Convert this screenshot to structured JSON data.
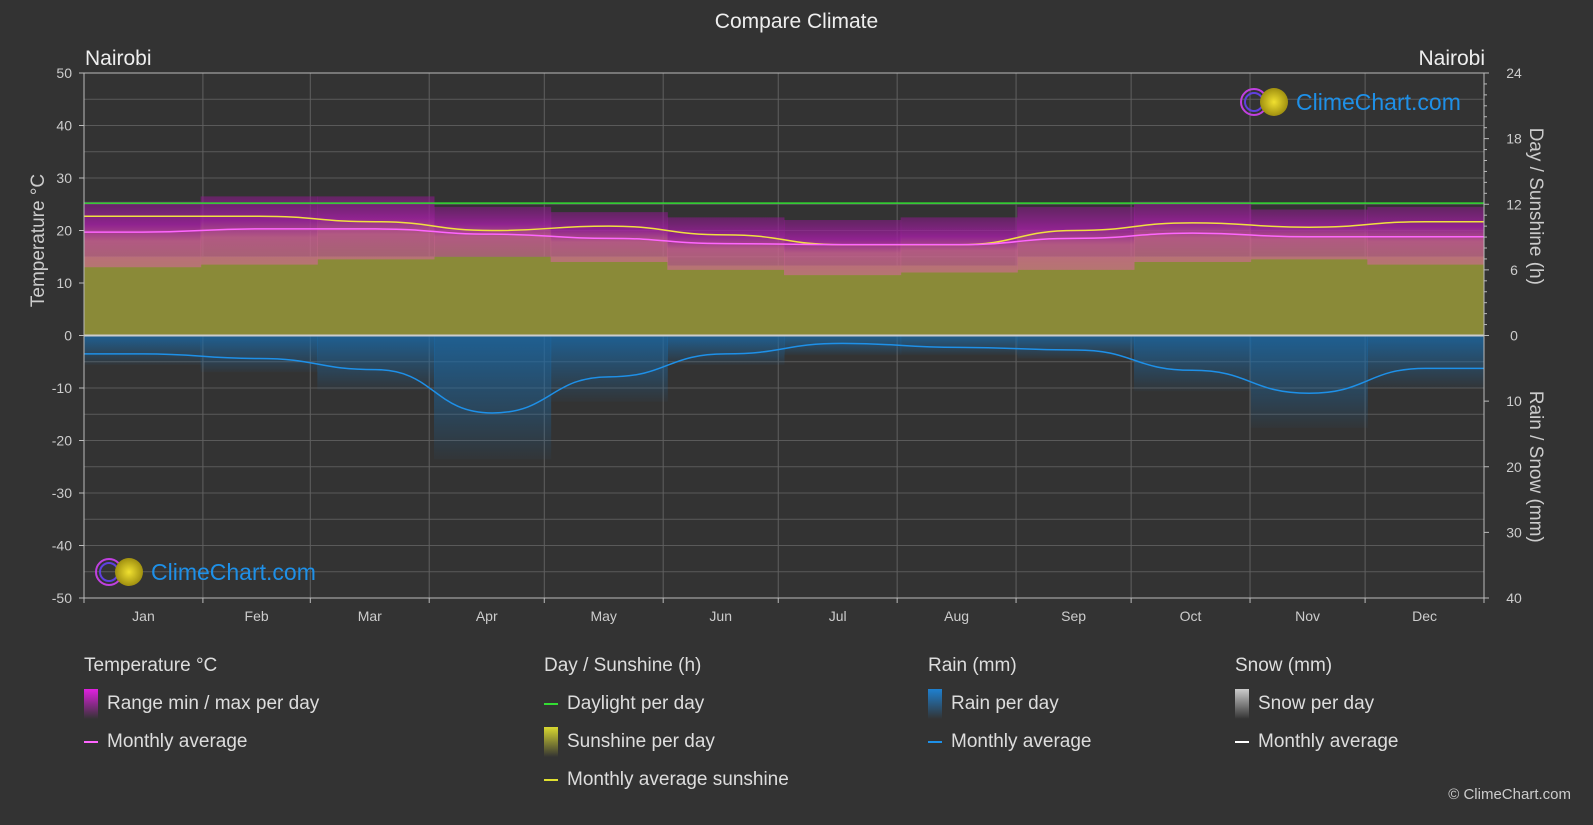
{
  "title": "Compare Climate",
  "city_left": "Nairobi",
  "city_right": "Nairobi",
  "logo_text": "ClimeChart.com",
  "copyright": "© ClimeChart.com",
  "colors": {
    "background": "#333333",
    "temp_range": "#e020e0",
    "temp_avg": "#ff66ff",
    "daylight": "#33dd33",
    "sunshine_fill": "#8a8a38",
    "sunshine_avg": "#f0e040",
    "rain_fill": "#1a6aa8",
    "rain_avg": "#1e90e8",
    "snow_avg": "#ffffff",
    "logo": "#1e90e8"
  },
  "chart_data": {
    "type": "area",
    "title": "Compare Climate",
    "categories": [
      "Jan",
      "Feb",
      "Mar",
      "Apr",
      "May",
      "Jun",
      "Jul",
      "Aug",
      "Sep",
      "Oct",
      "Nov",
      "Dec"
    ],
    "axes": {
      "left": {
        "label": "Temperature °C",
        "range": [
          -50,
          50
        ],
        "ticks": [
          50,
          40,
          30,
          20,
          10,
          0,
          -10,
          -20,
          -30,
          -40,
          -50
        ]
      },
      "right_top": {
        "label": "Day / Sunshine (h)",
        "range": [
          0,
          24
        ],
        "ticks": [
          24,
          18,
          12,
          6,
          0
        ]
      },
      "right_bottom": {
        "label": "Rain / Snow (mm)",
        "range": [
          0,
          40
        ],
        "ticks": [
          0,
          10,
          20,
          30,
          40
        ]
      }
    },
    "grid": true,
    "series": [
      {
        "name": "Temperature monthly average",
        "unit": "°C",
        "axis": "left",
        "values": [
          19.7,
          20.3,
          20.3,
          19.3,
          18.5,
          17.5,
          17.3,
          17.3,
          18.5,
          19.5,
          18.8,
          18.8
        ]
      },
      {
        "name": "Temperature daily max (approx)",
        "unit": "°C",
        "axis": "left",
        "values": [
          25.5,
          26.5,
          26.5,
          24.5,
          23.5,
          22.5,
          22.0,
          22.5,
          24.5,
          25.5,
          24.0,
          24.5
        ]
      },
      {
        "name": "Temperature daily min (approx)",
        "unit": "°C",
        "axis": "left",
        "values": [
          13.0,
          13.5,
          14.5,
          15.0,
          14.0,
          12.5,
          11.5,
          12.0,
          12.5,
          14.0,
          14.5,
          13.5
        ]
      },
      {
        "name": "Daylight per day",
        "unit": "h",
        "axis": "right_top",
        "values": [
          12.1,
          12.1,
          12.1,
          12.1,
          12.1,
          12.1,
          12.1,
          12.1,
          12.1,
          12.1,
          12.1,
          12.1
        ]
      },
      {
        "name": "Monthly average sunshine",
        "unit": "h",
        "axis": "right_top",
        "values": [
          10.9,
          10.9,
          10.4,
          9.6,
          10.0,
          9.2,
          8.3,
          8.3,
          9.6,
          10.3,
          9.9,
          10.4
        ]
      },
      {
        "name": "Rain monthly average",
        "unit": "mm",
        "axis": "right_bottom",
        "values": [
          2.8,
          3.5,
          5.2,
          11.8,
          6.3,
          2.8,
          1.2,
          1.8,
          2.2,
          5.3,
          8.8,
          5.0
        ]
      },
      {
        "name": "Snow monthly average",
        "unit": "mm",
        "axis": "right_bottom",
        "values": [
          0,
          0,
          0,
          0,
          0,
          0,
          0,
          0,
          0,
          0,
          0,
          0
        ]
      }
    ],
    "legend_placement": "bottom"
  },
  "legend": {
    "groups": [
      {
        "title": "Temperature °C",
        "items": [
          {
            "label": "Range min / max per day",
            "kind": "box",
            "color": "#e020e0"
          },
          {
            "label": "Monthly average",
            "kind": "line",
            "color": "#ff66ff"
          }
        ]
      },
      {
        "title": "Day / Sunshine (h)",
        "items": [
          {
            "label": "Daylight per day",
            "kind": "line",
            "color": "#33dd33"
          },
          {
            "label": "Sunshine per day",
            "kind": "box",
            "color": "#d8d830"
          },
          {
            "label": "Monthly average sunshine",
            "kind": "line",
            "color": "#e0e030"
          }
        ]
      },
      {
        "title": "Rain (mm)",
        "items": [
          {
            "label": "Rain per day",
            "kind": "box",
            "color": "#1e80d0"
          },
          {
            "label": "Monthly average",
            "kind": "line",
            "color": "#1e90e8"
          }
        ]
      },
      {
        "title": "Snow (mm)",
        "items": [
          {
            "label": "Snow per day",
            "kind": "box",
            "color": "#cccccc"
          },
          {
            "label": "Monthly average",
            "kind": "line",
            "color": "#ffffff"
          }
        ]
      }
    ]
  }
}
